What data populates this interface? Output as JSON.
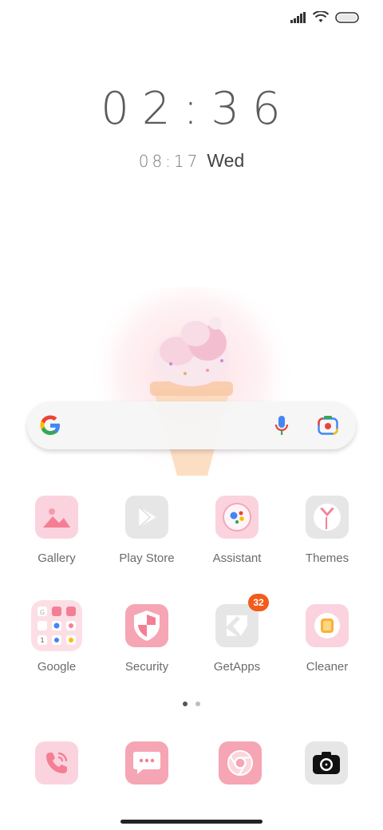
{
  "clock": {
    "time": "02:36"
  },
  "date": {
    "secondary_time": "08:17",
    "day": "Wed"
  },
  "search": {
    "provider_icon": "google-g-icon",
    "mic_icon": "mic-icon",
    "lens_icon": "lens-icon"
  },
  "apps": [
    {
      "label": "Gallery",
      "icon": "gallery-icon"
    },
    {
      "label": "Play Store",
      "icon": "play-store-icon"
    },
    {
      "label": "Assistant",
      "icon": "assistant-icon"
    },
    {
      "label": "Themes",
      "icon": "themes-icon"
    },
    {
      "label": "Google",
      "icon": "google-folder-icon"
    },
    {
      "label": "Security",
      "icon": "security-icon"
    },
    {
      "label": "GetApps",
      "icon": "getapps-icon",
      "badge": "32"
    },
    {
      "label": "Cleaner",
      "icon": "cleaner-icon"
    }
  ],
  "dock": [
    {
      "icon": "phone-icon"
    },
    {
      "icon": "messages-icon"
    },
    {
      "icon": "chrome-icon"
    },
    {
      "icon": "camera-icon"
    }
  ],
  "pages": {
    "count": 2,
    "active": 1
  },
  "colors": {
    "pink_light": "#fbd3df",
    "pink": "#f6a5b4",
    "gray_icon": "#e6e6e6",
    "badge": "#f25c1c"
  }
}
